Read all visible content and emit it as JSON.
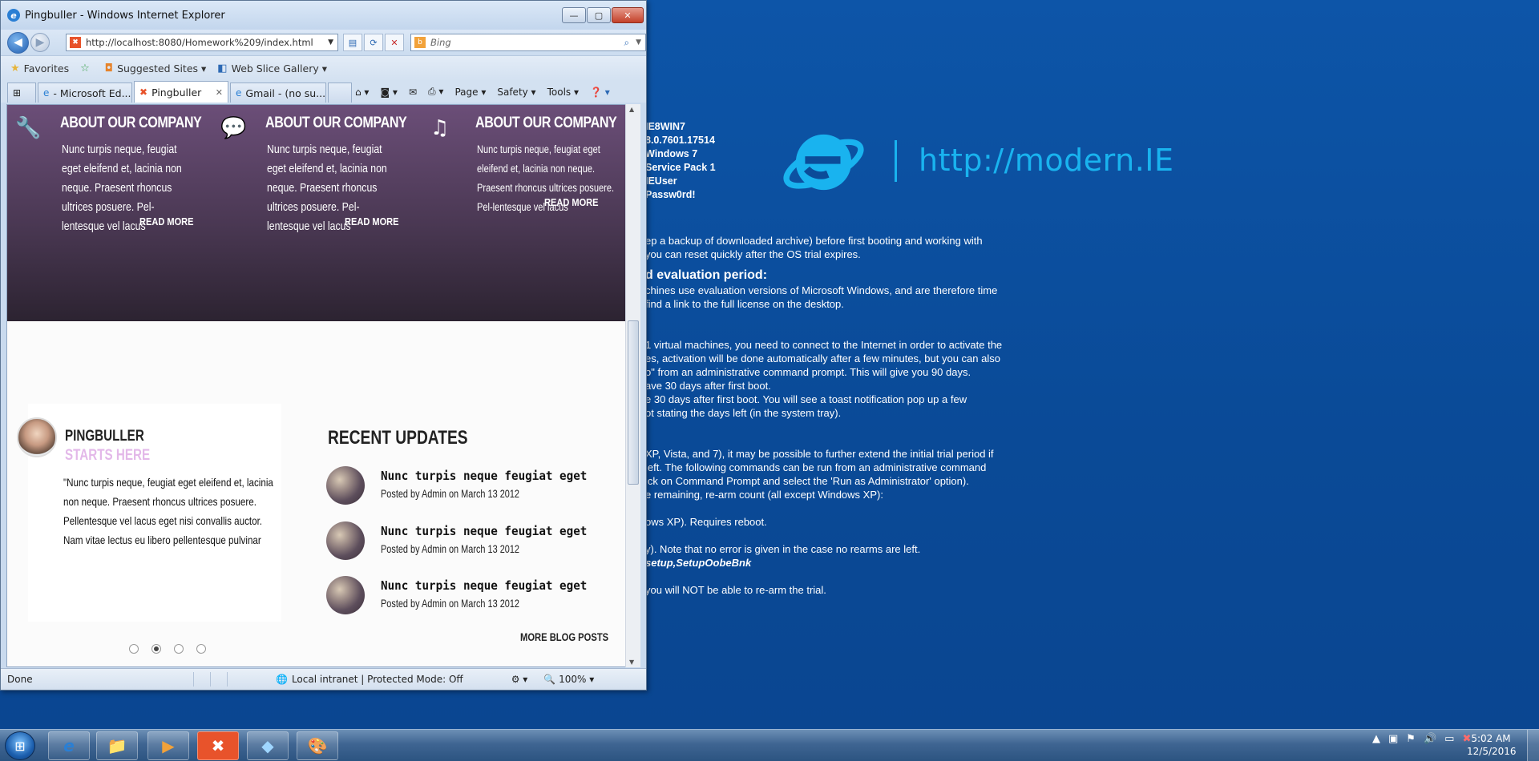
{
  "window": {
    "title": "Pingbuller - Windows Internet Explorer",
    "minimize_glyph": "—",
    "maximize_glyph": "▢",
    "close_glyph": "✕"
  },
  "nav": {
    "back_glyph": "◀",
    "forward_glyph": "▶",
    "address": "http://localhost:8080/Homework%209/index.html",
    "search_placeholder": "Bing"
  },
  "favorites_bar": {
    "favorites_label": "Favorites",
    "suggested_sites": "Suggested Sites ▾",
    "web_slice_gallery": "Web Slice Gallery ▾"
  },
  "tabs": [
    {
      "label": "- Microsoft Ed..."
    },
    {
      "label": "Pingbuller"
    },
    {
      "label": "Gmail - (no su..."
    }
  ],
  "command_bar": {
    "page": "Page ▾",
    "safety": "Safety ▾",
    "tools": "Tools ▾"
  },
  "page": {
    "features": [
      {
        "icon": "wrench-icon",
        "glyph": "🔧",
        "title": "ABOUT OUR COMPANY",
        "text": "Nunc turpis neque, feugiat eget eleifend et, lacinia non neque. Praesent rhoncus ultrices posuere. Pel-lentesque vel lacus",
        "more": "READ MORE"
      },
      {
        "icon": "speech-bubble-icon",
        "glyph": "💬",
        "title": "ABOUT OUR COMPANY",
        "text": "Nunc turpis neque, feugiat eget eleifend et, lacinia non neque. Praesent rhoncus ultrices posuere. Pel-lentesque vel lacus",
        "more": "READ MORE"
      },
      {
        "icon": "music-note-icon",
        "glyph": "♫",
        "title": "ABOUT OUR COMPANY",
        "text": "Nunc turpis neque, feugiat eget eleifend et, lacinia non neque. Praesent rhoncus ultrices posuere. Pel-lentesque vel lacus",
        "more": "READ MORE"
      }
    ],
    "profile": {
      "name": "PINGBULLER",
      "subtitle": "STARTS HERE",
      "quote": "\"Nunc turpis neque, feugiat eget eleifend et, lacinia non neque. Praesent rhoncus ultrices posuere. Pellentesque vel lacus eget nisi convallis auctor. Nam vitae lectus eu libero pellentesque pulvinar"
    },
    "recent": {
      "title": "RECENT UPDATES",
      "posts": [
        {
          "title": "Nunc turpis neque feugiat eget",
          "meta": "Posted by Admin on March 13 2012"
        },
        {
          "title": "Nunc turpis neque feugiat eget",
          "meta": "Posted by Admin on March 13 2012"
        },
        {
          "title": "Nunc turpis neque feugiat eget",
          "meta": "Posted by Admin on March 13 2012"
        }
      ],
      "more": "MORE BLOG POSTS"
    },
    "slider_active_index": 1
  },
  "status": {
    "left": "Done",
    "zone": "Local intranet | Protected Mode: Off",
    "zoom": "100%"
  },
  "desktop": {
    "info_lines": [
      "IE8WIN7",
      "8.0.7601.17514",
      "Windows 7",
      "Service Pack 1",
      "IEUser",
      "Passw0rd!"
    ],
    "brand_url": "http://modern.IE",
    "text_lines": [
      {
        "t": "ep a backup of downloaded archive) before first booting and working with"
      },
      {
        "t": "you can reset quickly after the OS trial expires."
      },
      {
        "t": "d evaluation period:",
        "h": true
      },
      {
        "t": "chines use evaluation versions of Microsoft Windows, and are therefore time"
      },
      {
        "t": "find a link to the full license on the desktop."
      },
      {
        "t": "",
        "gap": true
      },
      {
        "t": "",
        "gap": true
      },
      {
        "t": "1 virtual machines, you need to connect to the Internet in order to activate the"
      },
      {
        "t": "es, activation will be done automatically after a few minutes, but you can also"
      },
      {
        "t": "o\" from an administrative command prompt. This will give you 90 days."
      },
      {
        "t": "ave 30 days after first boot."
      },
      {
        "t": "e 30 days after first boot. You will see a toast notification pop up a few"
      },
      {
        "t": "ot stating the days left (in the system tray)."
      },
      {
        "t": "",
        "gap": true
      },
      {
        "t": "",
        "gap": true
      },
      {
        "t": "XP, Vista, and 7), it may be possible to further extend the initial trial period if"
      },
      {
        "t": "left. The following commands can be run from an administrative command"
      },
      {
        "t": "ick on Command Prompt and select the 'Run as Administrator' option)."
      },
      {
        "t": "e remaining, re-arm count (all except Windows XP):"
      },
      {
        "t": "",
        "gap": true
      },
      {
        "t": "ows XP). Requires reboot."
      },
      {
        "t": "",
        "gap": true
      },
      {
        "t": "y). Note that no error is given in the case no rearms are left."
      },
      {
        "t": "setup,SetupOobeBnk",
        "b": true
      },
      {
        "t": "",
        "gap": true
      },
      {
        "t": "you will NOT be able to re-arm the trial."
      }
    ]
  },
  "taskbar": {
    "items": [
      {
        "name": "taskbar-ie-icon",
        "glyph": "e"
      },
      {
        "name": "taskbar-explorer-icon",
        "glyph": "📁"
      },
      {
        "name": "taskbar-media-player-icon",
        "glyph": "▶"
      },
      {
        "name": "taskbar-xampp-icon",
        "glyph": "✖"
      },
      {
        "name": "taskbar-app-icon",
        "glyph": "◆"
      },
      {
        "name": "taskbar-paint-icon",
        "glyph": "🎨"
      }
    ],
    "time": "5:02 AM",
    "date": "12/5/2016"
  },
  "colors": {
    "desktop_bg": "#0b4c99",
    "hero_top": "#6b4e78",
    "hero_bottom": "#2c2331",
    "brand_cyan": "#19b3ef",
    "profile_subtitle": "#e3b8e9"
  }
}
